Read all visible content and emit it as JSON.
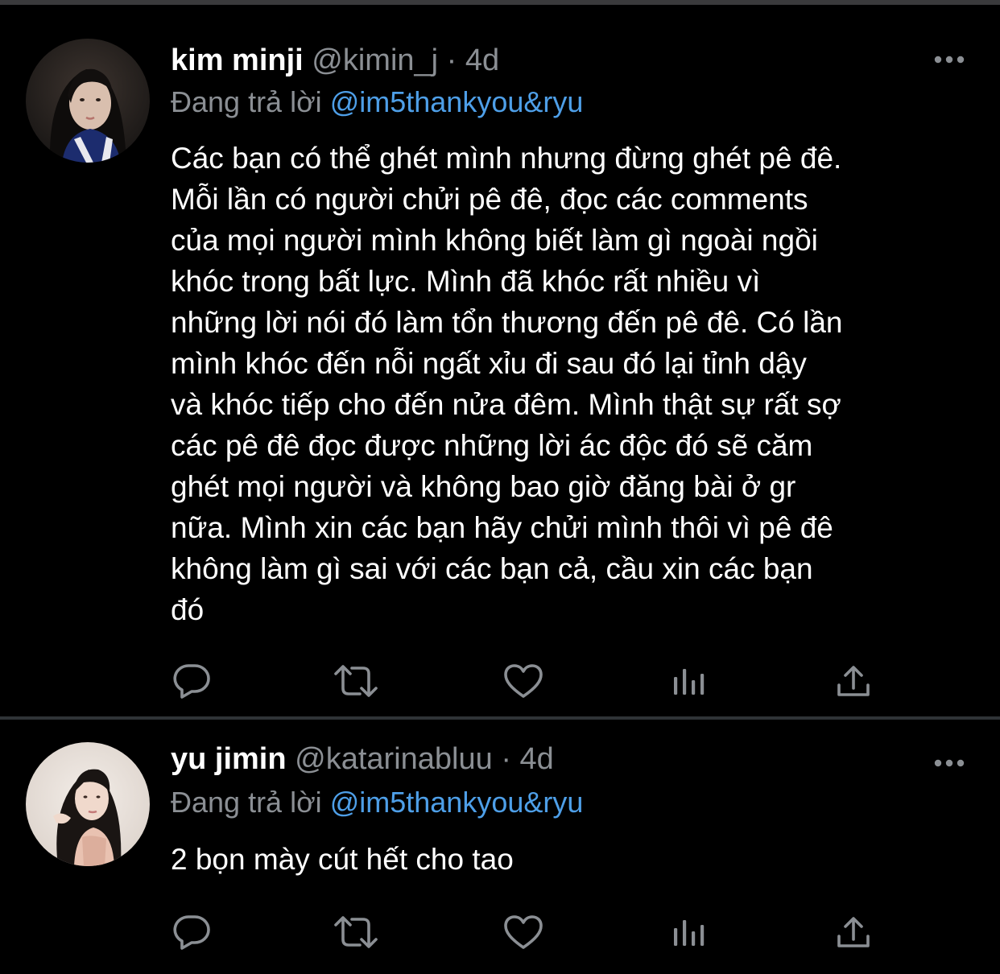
{
  "tweets": [
    {
      "display_name": "kim minji",
      "handle": "@kimin_j",
      "separator": "·",
      "time": "4d",
      "reply_prefix": "Đang trả lời",
      "reply_to": "@im5thankyou&ryu",
      "text": "Các bạn có thể ghét mình nhưng đừng ghét pê đê.\nMỗi lần có người chửi pê đê, đọc các comments\ncủa mọi người mình không biết làm gì ngoài ngồi\nkhóc trong bất lực. Mình đã khóc rất nhiều vì\nnhững lời nói đó làm tổn thương đến pê đê. Có lần\nmình khóc đến nỗi ngất xỉu đi sau đó lại tỉnh dậy\nvà khóc tiếp cho đến nửa đêm. Mình thật sự rất sợ\ncác pê đê đọc được những lời ác độc đó sẽ căm\nghét mọi người và không bao giờ đăng bài ở gr\nnữa. Mình xin các bạn hãy chửi mình thôi vì pê đê\nkhông làm gì sai với các bạn cả, cầu xin các bạn\nđó"
    },
    {
      "display_name": "yu jimin",
      "handle": "@katarinabluu",
      "separator": "·",
      "time": "4d",
      "reply_prefix": "Đang trả lời",
      "reply_to": "@im5thankyou&ryu",
      "text": "2 bọn mày cút hết cho tao"
    }
  ],
  "icons": {
    "more": "more-horizontal-icon",
    "reply": "reply-bubble-icon",
    "retweet": "retweet-icon",
    "like": "heart-icon",
    "stats": "bar-chart-icon",
    "share": "share-upload-icon"
  },
  "colors": {
    "background": "#000000",
    "text": "#ffffff",
    "muted": "#8b8f94",
    "link": "#4e9fe8",
    "divider": "#2f3336"
  }
}
